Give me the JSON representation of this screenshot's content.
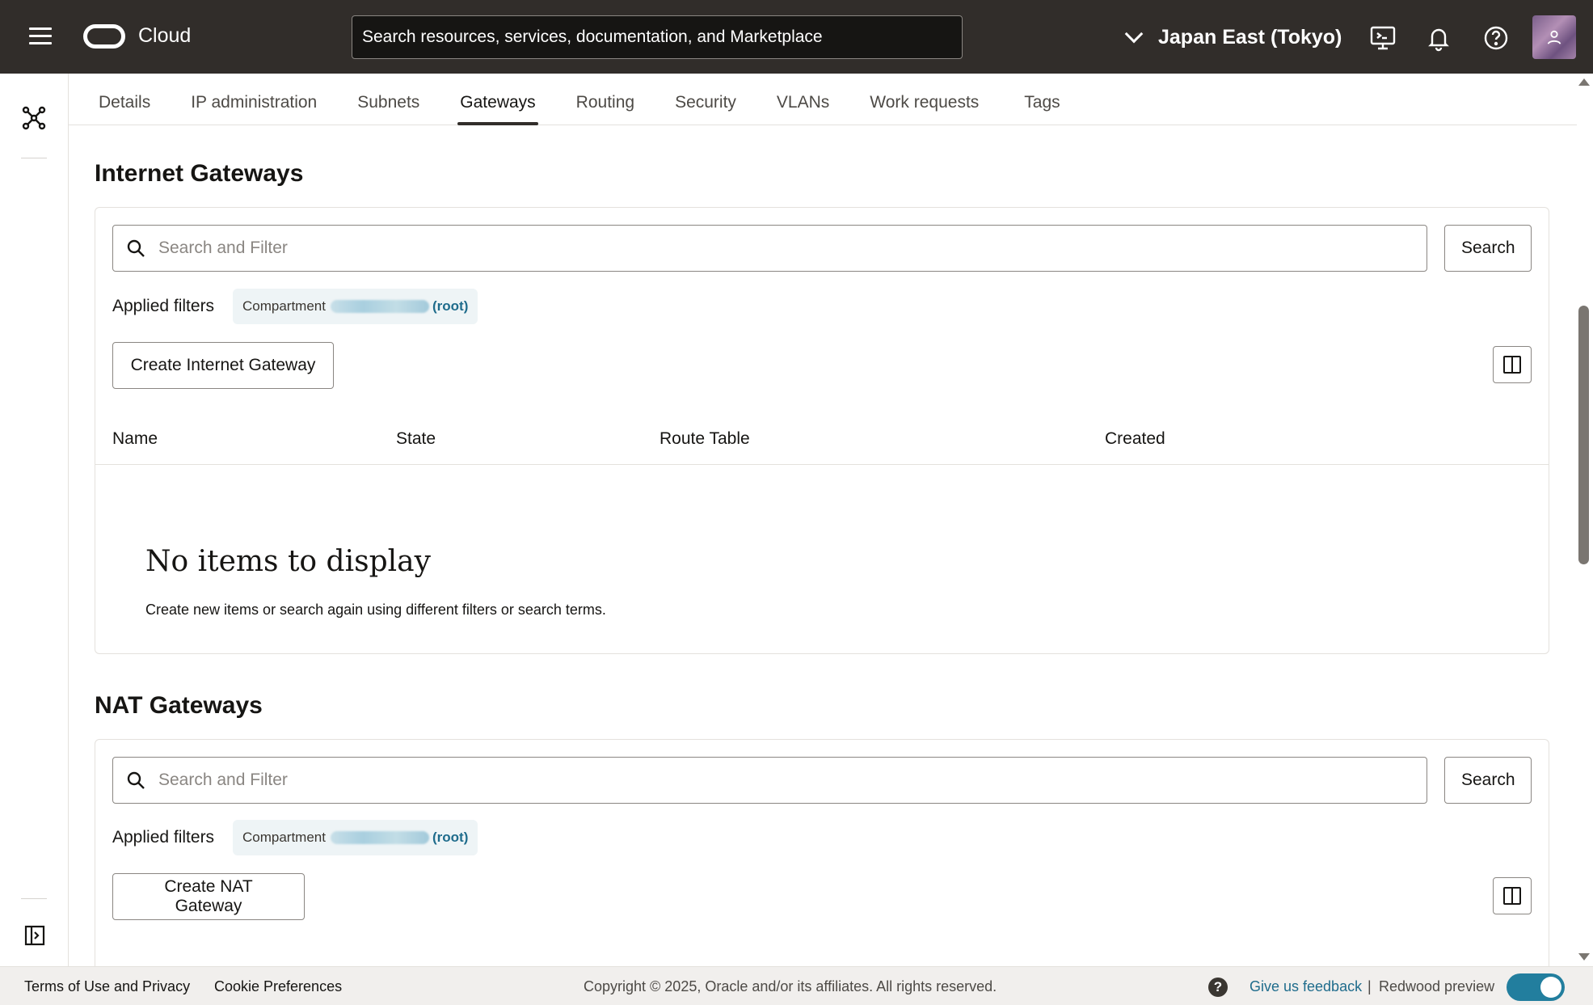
{
  "header": {
    "brand": "Cloud",
    "search_placeholder": "Search resources, services, documentation, and Marketplace",
    "region": "Japan East (Tokyo)"
  },
  "tabs": [
    "Details",
    "IP administration",
    "Subnets",
    "Gateways",
    "Routing",
    "Security",
    "VLANs",
    "Work requests",
    "Tags"
  ],
  "active_tab": "Gateways",
  "internet_gateways": {
    "title": "Internet Gateways",
    "search_placeholder": "Search and Filter",
    "search_button": "Search",
    "filters_label": "Applied filters",
    "chip_label": "Compartment",
    "chip_root": "(root)",
    "create_button": "Create Internet Gateway",
    "columns": [
      "Name",
      "State",
      "Route Table",
      "Created"
    ],
    "empty_title": "No items to display",
    "empty_subtitle": "Create new items or search again using different filters or search terms."
  },
  "nat_gateways": {
    "title": "NAT Gateways",
    "search_placeholder": "Search and Filter",
    "search_button": "Search",
    "filters_label": "Applied filters",
    "chip_label": "Compartment",
    "chip_root": "(root)",
    "create_button": "Create NAT Gateway"
  },
  "footer": {
    "terms": "Terms of Use and Privacy",
    "cookies": "Cookie Preferences",
    "copyright": "Copyright © 2025, Oracle and/or its affiliates. All rights reserved.",
    "help": "?",
    "feedback": "Give us feedback",
    "separator": "|",
    "redwood": "Redwood preview"
  },
  "colors": {
    "header_bg": "#312d2a",
    "accent": "#227e9e",
    "link": "#1f6c8c"
  }
}
